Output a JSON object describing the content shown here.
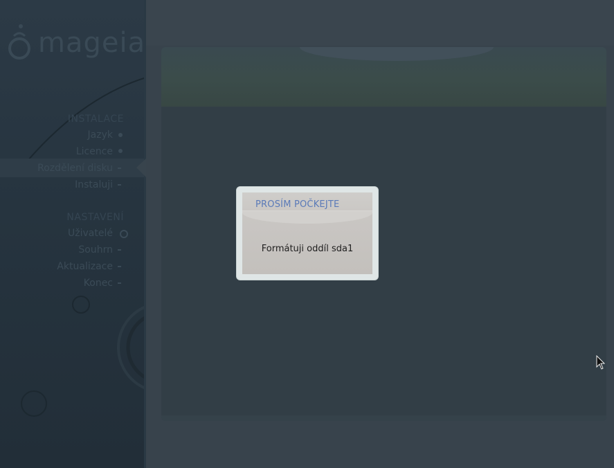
{
  "brand": {
    "logo_text": "mageia"
  },
  "sidebar": {
    "sections": [
      {
        "title": "INSTALACE",
        "steps": [
          {
            "label": "Jazyk",
            "state": "done"
          },
          {
            "label": "Licence",
            "state": "done"
          },
          {
            "label": "Rozdělení disku",
            "state": "active"
          },
          {
            "label": "Instaluji",
            "state": "pending"
          }
        ]
      },
      {
        "title": "NASTAVENÍ",
        "steps": [
          {
            "label": "Uživatelé",
            "state": "pending"
          },
          {
            "label": "Souhrn",
            "state": "pending"
          },
          {
            "label": "Aktualizace",
            "state": "pending"
          },
          {
            "label": "Konec",
            "state": "pending"
          }
        ]
      }
    ]
  },
  "dialog": {
    "title": "PROSÍM POČKEJTE",
    "message": "Formátuji oddíl sda1"
  },
  "colors": {
    "dialog_title": "#5a7ab8",
    "sidebar_bg": "#26343f",
    "main_bg": "#38434c"
  },
  "icons": {
    "logo": "mageia-cauldron-icon",
    "pointer": "mouse-pointer-icon"
  }
}
